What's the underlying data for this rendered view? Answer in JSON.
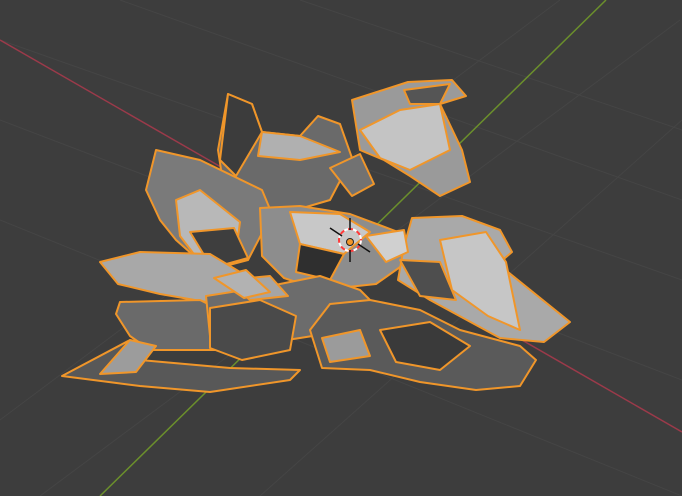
{
  "viewport": {
    "background_color": "#3d3d3d",
    "grid_visible": true,
    "grid_line_color": "#454545",
    "x_axis_color": "#9b3a4a",
    "y_axis_color": "#6b8f2c",
    "selection_outline_color": "#f0962a",
    "active_selection": true,
    "selected_object": "shattered-rock-fragments",
    "object_origin_visible": true,
    "cursor_3d_visible": true,
    "cursor_3d_colors": [
      "#ff3b3b",
      "#ffffff"
    ],
    "shading_colors": {
      "light": "#b9b9b9",
      "mid": "#8a8a8a",
      "dark": "#4a4a4a",
      "darkest": "#353535"
    }
  }
}
